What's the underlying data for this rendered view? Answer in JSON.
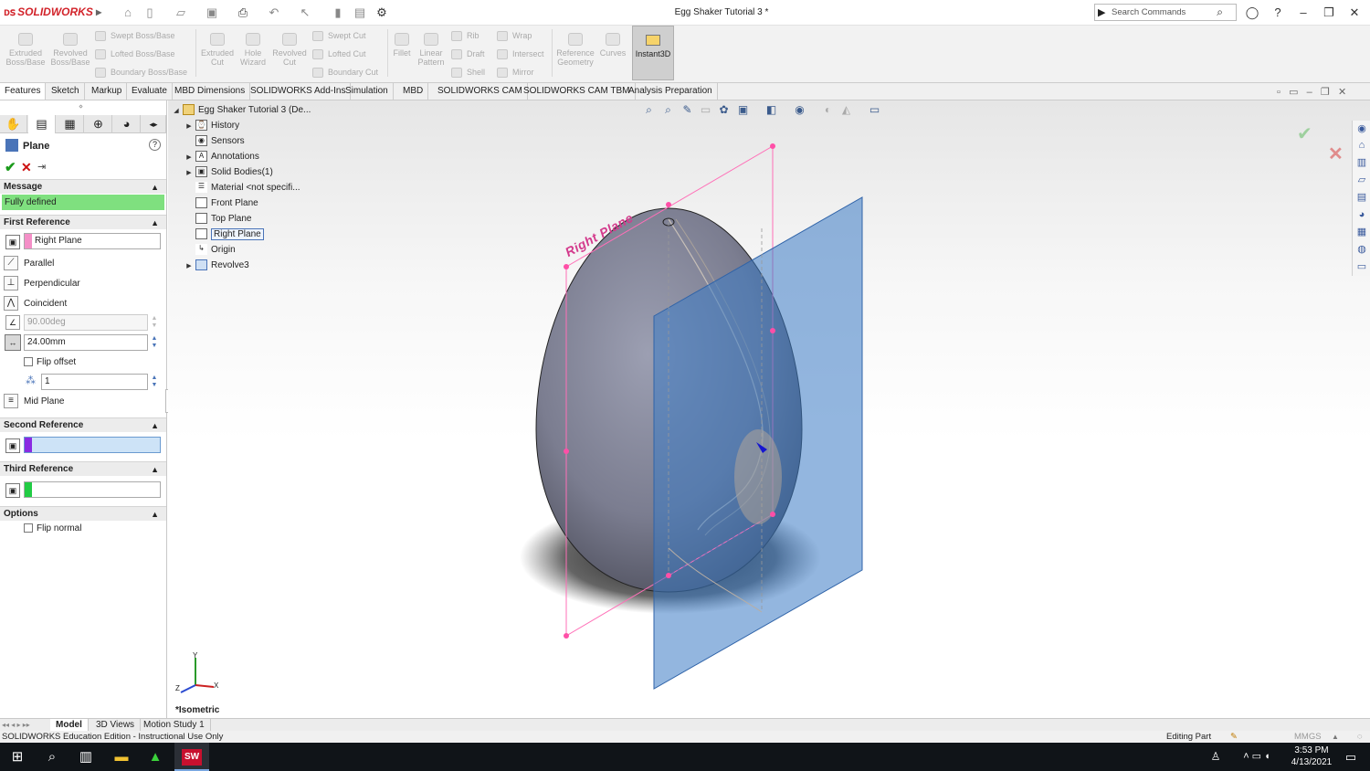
{
  "app": {
    "title": "Egg Shaker Tutorial 3 *",
    "brand": "SOLIDWORKS"
  },
  "search": {
    "placeholder": "Search Commands"
  },
  "ribbon": {
    "extruded_boss": "Extruded Boss/Base",
    "revolved_boss": "Revolved Boss/Base",
    "swept_boss": "Swept Boss/Base",
    "lofted_boss": "Lofted Boss/Base",
    "boundary_boss": "Boundary Boss/Base",
    "extruded_cut": "Extruded Cut",
    "hole_wizard": "Hole Wizard",
    "revolved_cut": "Revolved Cut",
    "swept_cut": "Swept Cut",
    "lofted_cut": "Lofted Cut",
    "boundary_cut": "Boundary Cut",
    "fillet": "Fillet",
    "linear_pattern": "Linear Pattern",
    "rib": "Rib",
    "draft": "Draft",
    "shell": "Shell",
    "wrap": "Wrap",
    "intersect": "Intersect",
    "mirror": "Mirror",
    "reference_geometry": "Reference Geometry",
    "curves": "Curves",
    "instant3d": "Instant3D"
  },
  "tabs": [
    "Features",
    "Sketch",
    "Markup",
    "Evaluate",
    "MBD Dimensions",
    "SOLIDWORKS Add-Ins",
    "Simulation",
    "MBD",
    "SOLIDWORKS CAM",
    "SOLIDWORKS CAM TBM",
    "Analysis Preparation"
  ],
  "panel": {
    "title": "Plane",
    "message_header": "Message",
    "message": "Fully defined",
    "first_ref_header": "First Reference",
    "first_ref_value": "Right Plane",
    "parallel": "Parallel",
    "perpendicular": "Perpendicular",
    "coincident": "Coincident",
    "angle_value": "90.00deg",
    "offset_value": "24.00mm",
    "flip_offset": "Flip offset",
    "count_value": "1",
    "mid_plane": "Mid Plane",
    "second_ref_header": "Second Reference",
    "third_ref_header": "Third Reference",
    "options_header": "Options",
    "flip_normal": "Flip normal",
    "colors": {
      "first": "#f48fc7",
      "second": "#8a2be2",
      "third": "#22cc44",
      "message_bg": "#7fe07f"
    }
  },
  "tree": {
    "root": "Egg Shaker Tutorial 3  (De...",
    "items": [
      "History",
      "Sensors",
      "Annotations",
      "Solid Bodies(1)",
      "Material <not specifi...",
      "Front Plane",
      "Top Plane",
      "Right Plane",
      "Origin",
      "Revolve3"
    ]
  },
  "viewport": {
    "plane_label": "Right Plane",
    "view_name": "*Isometric"
  },
  "bottom_tabs": [
    "Model",
    "3D Views",
    "Motion Study 1"
  ],
  "status": {
    "left": "SOLIDWORKS Education Edition - Instructional Use Only",
    "mode": "Editing Part",
    "units": "MMGS"
  },
  "clock": {
    "time": "3:53 PM",
    "date": "4/13/2021"
  }
}
